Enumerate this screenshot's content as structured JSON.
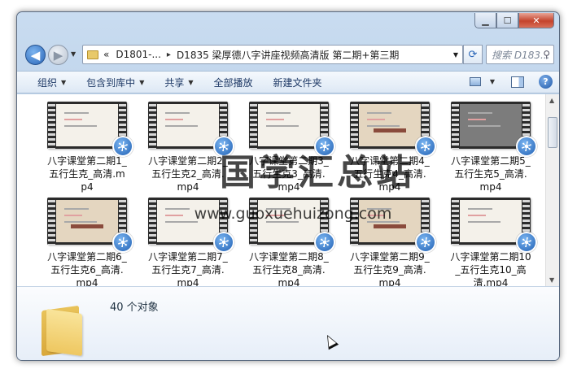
{
  "window": {
    "caption": {
      "minimize_glyph": "▁",
      "maximize_glyph": "☐",
      "close_glyph": "✕"
    }
  },
  "nav": {
    "back_glyph": "◀",
    "forward_glyph": "▶",
    "address": {
      "prefix": "«",
      "crumbs": [
        "D1801-...",
        "D1835 梁厚德八字讲座视频高清版 第二期+第三期"
      ],
      "separator": "▸"
    },
    "refresh_glyph": "⟳",
    "search_placeholder": "搜索 D183..."
  },
  "toolbar": {
    "organize": "组织",
    "include_library": "包含到库中",
    "share": "共享",
    "play_all": "全部播放",
    "new_folder": "新建文件夹"
  },
  "files": [
    {
      "name": "八字课堂第二期1_五行生克_高清.mp4",
      "frame": "light"
    },
    {
      "name": "八字课堂第二期2_五行生克2_高清.mp4",
      "frame": "light"
    },
    {
      "name": "八字课堂第二期3_五行生克3_高清.mp4",
      "frame": "light"
    },
    {
      "name": "八字课堂第二期4_五行生克4_高清.mp4",
      "frame": "beige"
    },
    {
      "name": "八字课堂第二期5_五行生克5_高清.mp4",
      "frame": "dark"
    },
    {
      "name": "八字课堂第二期6_五行生克6_高清.mp4",
      "frame": "beige"
    },
    {
      "name": "八字课堂第二期7_五行生克7_高清.mp4",
      "frame": "light"
    },
    {
      "name": "八字课堂第二期8_五行生克8_高清.mp4",
      "frame": "light"
    },
    {
      "name": "八字课堂第二期9_五行生克9_高清.mp4",
      "frame": "beige"
    },
    {
      "name": "八字课堂第二期10_五行生克10_高清.mp4",
      "frame": "light"
    }
  ],
  "details": {
    "count": "40 个对象"
  },
  "watermark": {
    "text": "国学汇总站",
    "url": "www.guoxuehuizong.com"
  }
}
